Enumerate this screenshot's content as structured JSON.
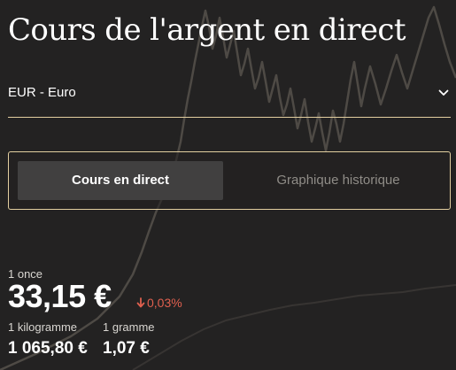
{
  "header": {
    "title": "Cours de l'argent en direct"
  },
  "currency_select": {
    "selected": "EUR - Euro",
    "icon": "chevron-down-icon"
  },
  "tabs": [
    {
      "label": "Cours en direct",
      "active": true
    },
    {
      "label": "Graphique historique",
      "active": false
    }
  ],
  "price": {
    "unit_label": "1 once",
    "value": "33,15 €",
    "change": "0,03%",
    "change_direction": "down",
    "change_icon": "arrow-down-icon"
  },
  "conversions": [
    {
      "label": "1 kilogramme",
      "value": "1 065,80 €"
    },
    {
      "label": "1 gramme",
      "value": "1,07 €"
    }
  ],
  "colors": {
    "background": "#232222",
    "accent_border": "#e3cfa0",
    "active_tab": "#414040",
    "negative": "#e0604f",
    "background_chart_line": "#e8dcc2"
  }
}
